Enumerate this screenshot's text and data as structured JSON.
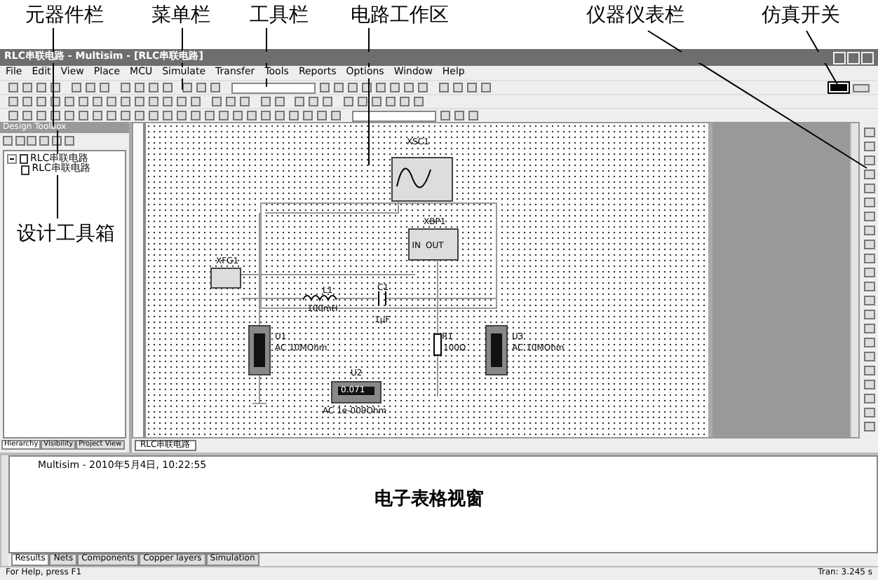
{
  "annotations": [
    {
      "text": "元器件栏"
    },
    {
      "text": "菜单栏"
    },
    {
      "text": "工具栏"
    },
    {
      "text": "电路工作区"
    },
    {
      "text": "仪器仪表栏"
    },
    {
      "text": "仿真开关"
    },
    {
      "text": "设计工具箱"
    }
  ],
  "window": {
    "title": "RLC串联电路 - Multisim - [RLC串联电路]"
  },
  "menu": [
    "File",
    "Edit",
    "View",
    "Place",
    "MCU",
    "Simulate",
    "Transfer",
    "Tools",
    "Reports",
    "Options",
    "Window",
    "Help"
  ],
  "design_toolbox": {
    "title": "Design Toolbox",
    "tree": [
      {
        "label": "RLC串联电路",
        "expanded": true,
        "children": [
          {
            "label": "RLC串联电路"
          }
        ]
      }
    ],
    "tabs": [
      {
        "label": "Hierarchy",
        "selected": true
      },
      {
        "label": "Visibility",
        "selected": false
      },
      {
        "label": "Project View",
        "selected": false
      }
    ]
  },
  "workspace": {
    "components": [
      {
        "kind": "scope",
        "ref": "XSC1"
      },
      {
        "kind": "bode",
        "ref": "XBP1",
        "pins": [
          "IN",
          "OUT"
        ]
      },
      {
        "kind": "fgen",
        "ref": "XFG1"
      },
      {
        "kind": "inductor",
        "ref": "L1",
        "value": "100mH"
      },
      {
        "kind": "capacitor",
        "ref": "C1",
        "value": "1µF"
      },
      {
        "kind": "vmeter",
        "ref": "U1",
        "value": "AC  10MOhm"
      },
      {
        "kind": "hmeter",
        "ref": "U2",
        "value": "AC  1e-009Ohm",
        "reading": "0.071"
      },
      {
        "kind": "resistor",
        "ref": "R1",
        "value": "100Ω"
      },
      {
        "kind": "vmeter",
        "ref": "U3",
        "value": "AC  10MOhm"
      }
    ],
    "sheet_tabs": [
      {
        "label": "RLC串联电路",
        "selected": true
      }
    ]
  },
  "spreadsheet": {
    "log": "Multisim  -  2010年5月4日, 10:22:55",
    "caption": "电子表格视窗",
    "tabs": [
      {
        "label": "Results",
        "selected": true
      },
      {
        "label": "Nets",
        "selected": false
      },
      {
        "label": "Components",
        "selected": false
      },
      {
        "label": "Copper layers",
        "selected": false
      },
      {
        "label": "Simulation",
        "selected": false
      }
    ]
  },
  "status_bar": {
    "left": "For Help, press F1",
    "right": "Tran: 3.245 s"
  }
}
